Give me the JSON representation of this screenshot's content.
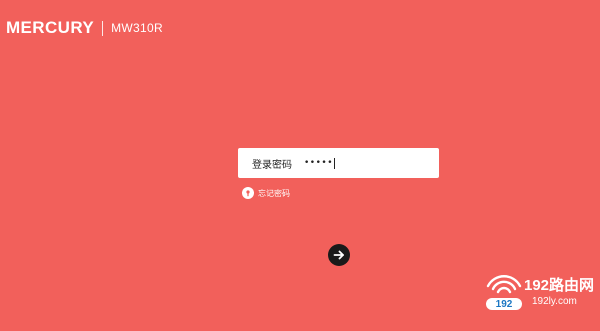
{
  "header": {
    "brand": "MERCURY",
    "model": "MW310R"
  },
  "login": {
    "label": "登录密码",
    "password_mask": "•••••"
  },
  "forgot": {
    "label": "忘记密码"
  },
  "submit": {
    "icon": "arrow-right-icon"
  },
  "watermark": {
    "title": "192路由网",
    "url": "192ly.com",
    "badge": "192"
  },
  "colors": {
    "background": "#f2605b",
    "button": "#1a1a1a",
    "watermark_badge_text": "#1c77c3"
  }
}
